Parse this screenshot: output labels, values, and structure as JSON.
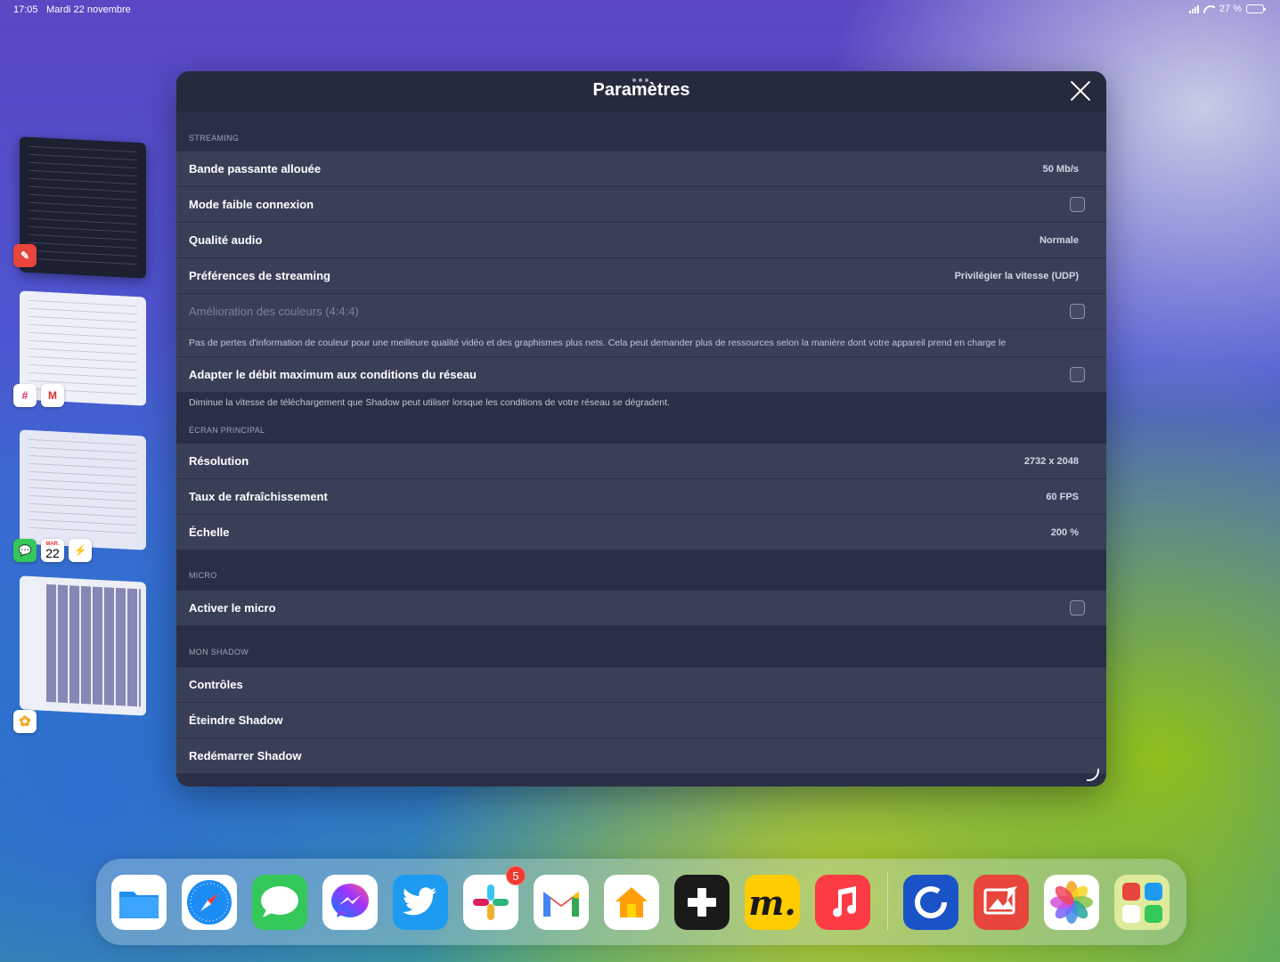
{
  "status_bar": {
    "time": "17:05",
    "date": "Mardi 22 novembre",
    "battery": "27 %",
    "battery_level": 0.27
  },
  "switcher": {
    "calendar_month": "MAR.",
    "calendar_day": "22"
  },
  "settings": {
    "title": "Paramètres",
    "sections": {
      "streaming": {
        "header": "STREAMING",
        "bandwidth": {
          "label": "Bande passante allouée",
          "value": "50 Mb/s"
        },
        "low_connection": {
          "label": "Mode faible connexion"
        },
        "audio_quality": {
          "label": "Qualité audio",
          "value": "Normale"
        },
        "streaming_prefs": {
          "label": "Préférences de streaming",
          "value": "Privilégier la vitesse (UDP)"
        },
        "color_enhancement": {
          "label": "Amélioration des couleurs (4:4:4)",
          "description": "Pas de pertes d'information de couleur pour une meilleure qualité vidéo et des graphismes plus nets. Cela peut demander plus de ressources selon la manière dont votre appareil prend en charge le"
        },
        "adapt_bitrate": {
          "label": "Adapter le débit maximum aux conditions du réseau",
          "description": "Diminue la vitesse de téléchargement que Shadow peut utiliser lorsque les conditions de votre réseau se dégradent."
        }
      },
      "main_screen": {
        "header": "ÉCRAN PRINCIPAL",
        "resolution": {
          "label": "Résolution",
          "value": "2732 x 2048"
        },
        "refresh_rate": {
          "label": "Taux de rafraîchissement",
          "value": "60 FPS"
        },
        "scale": {
          "label": "Échelle",
          "value": "200 %"
        }
      },
      "micro": {
        "header": "MICRO",
        "enable_micro": {
          "label": "Activer le micro"
        }
      },
      "my_shadow": {
        "header": "MON SHADOW",
        "controls": {
          "label": "Contrôles"
        },
        "shutdown": {
          "label": "Éteindre Shadow"
        },
        "restart": {
          "label": "Redémarrer Shadow"
        }
      }
    }
  },
  "dock": {
    "slack_badge": "5",
    "apps": [
      "Fichiers",
      "Safari",
      "Messages",
      "Messenger",
      "Twitter",
      "Slack",
      "Gmail",
      "Maison",
      "Shadow",
      "Marvel",
      "Musique",
      "Shadow PC",
      "Affinity",
      "Photos",
      "Dossier"
    ]
  },
  "colors": {
    "modal_bg": "#2b2f45",
    "row_bg": "#3a3f58",
    "header_bg": "#262a3d",
    "badge": "#f23b30"
  }
}
